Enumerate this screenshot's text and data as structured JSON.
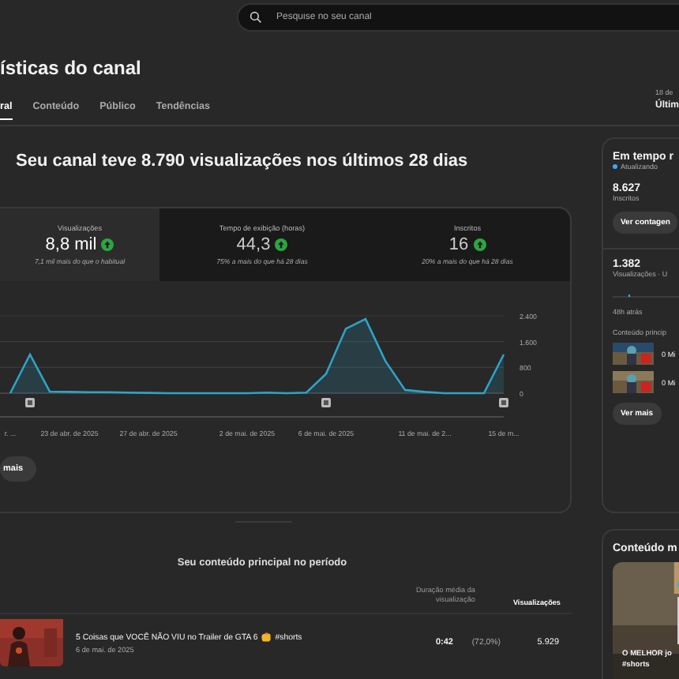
{
  "search": {
    "placeholder": "Pesquise no seu canal"
  },
  "page_title": "ísticas do canal",
  "tabs": [
    {
      "label": "ral",
      "selected": true
    },
    {
      "label": "Conteúdo",
      "selected": false
    },
    {
      "label": "Público",
      "selected": false
    },
    {
      "label": "Tendências",
      "selected": false
    }
  ],
  "date_range": {
    "caption": "18 de",
    "label": "Últim"
  },
  "summary": {
    "heading": "Seu canal teve 8.790 visualizações nos últimos 28 dias",
    "metrics": [
      {
        "label": "Visualizações",
        "value": "8,8 mil",
        "note": "7,1 mil mais do que o habitual",
        "selected": true
      },
      {
        "label": "Tempo de exibição (horas)",
        "value": "44,3",
        "note": "75% a mais do que há 28 dias",
        "selected": false
      },
      {
        "label": "Inscritos",
        "value": "16",
        "note": "20% a mais do que há 28 dias",
        "selected": false
      }
    ],
    "chart_data": {
      "type": "area",
      "ylim": [
        0,
        2400
      ],
      "yticks": [
        {
          "value": 0,
          "label": "0"
        },
        {
          "value": 800,
          "label": "800"
        },
        {
          "value": 1600,
          "label": "1.600"
        },
        {
          "value": 2400,
          "label": "2.400"
        }
      ],
      "categories": [
        "r. ...",
        null,
        null,
        "23 de abr. de 2025",
        null,
        null,
        null,
        "27 de abr. de 2025",
        null,
        null,
        null,
        null,
        "2 de mai. de 2025",
        null,
        null,
        null,
        "6 de mai. de 2025",
        null,
        null,
        null,
        null,
        "11 de mai. de 2...",
        null,
        null,
        null,
        "15 de m..."
      ],
      "series": [
        {
          "color": "#2ea3c7",
          "values": [
            0,
            1200,
            50,
            40,
            30,
            30,
            20,
            10,
            0,
            0,
            0,
            0,
            0,
            20,
            0,
            20,
            600,
            2000,
            2300,
            1000,
            100,
            40,
            0,
            0,
            0,
            1200
          ]
        }
      ]
    },
    "more_button": "mais"
  },
  "top_content": {
    "title": "Seu conteúdo principal no período",
    "columns": [
      {
        "label": "Duração média da visualização",
        "sorted": false
      },
      {
        "label": "Visualizações",
        "sorted": true
      }
    ],
    "rows": [
      {
        "title": "5 Coisas que VOCÊ NÃO VIU no Trailer de GTA 6",
        "title_suffix": "#shorts",
        "date": "6 de mai. de 2025",
        "avg_duration": "0:42",
        "avg_percent": "(72,0%)",
        "views": "5.929"
      }
    ]
  },
  "realtime": {
    "title": "Em tempo r",
    "status": "Atualizando",
    "subscribers": "8.627",
    "subscribers_label": "Inscritos",
    "count_button": "Ver contagen",
    "views": "1.382",
    "views_label": "Visualizações · U",
    "time_label": "48h atrás",
    "content_label": "Conteúdo princip",
    "items": [
      {
        "views": "0 Mi"
      },
      {
        "views": "0 Mi"
      }
    ],
    "more_button": "Ver mais"
  },
  "content_card": {
    "title": "Conteúdo m",
    "video": {
      "title": "O MELHOR jo",
      "tag": "#shorts"
    }
  }
}
